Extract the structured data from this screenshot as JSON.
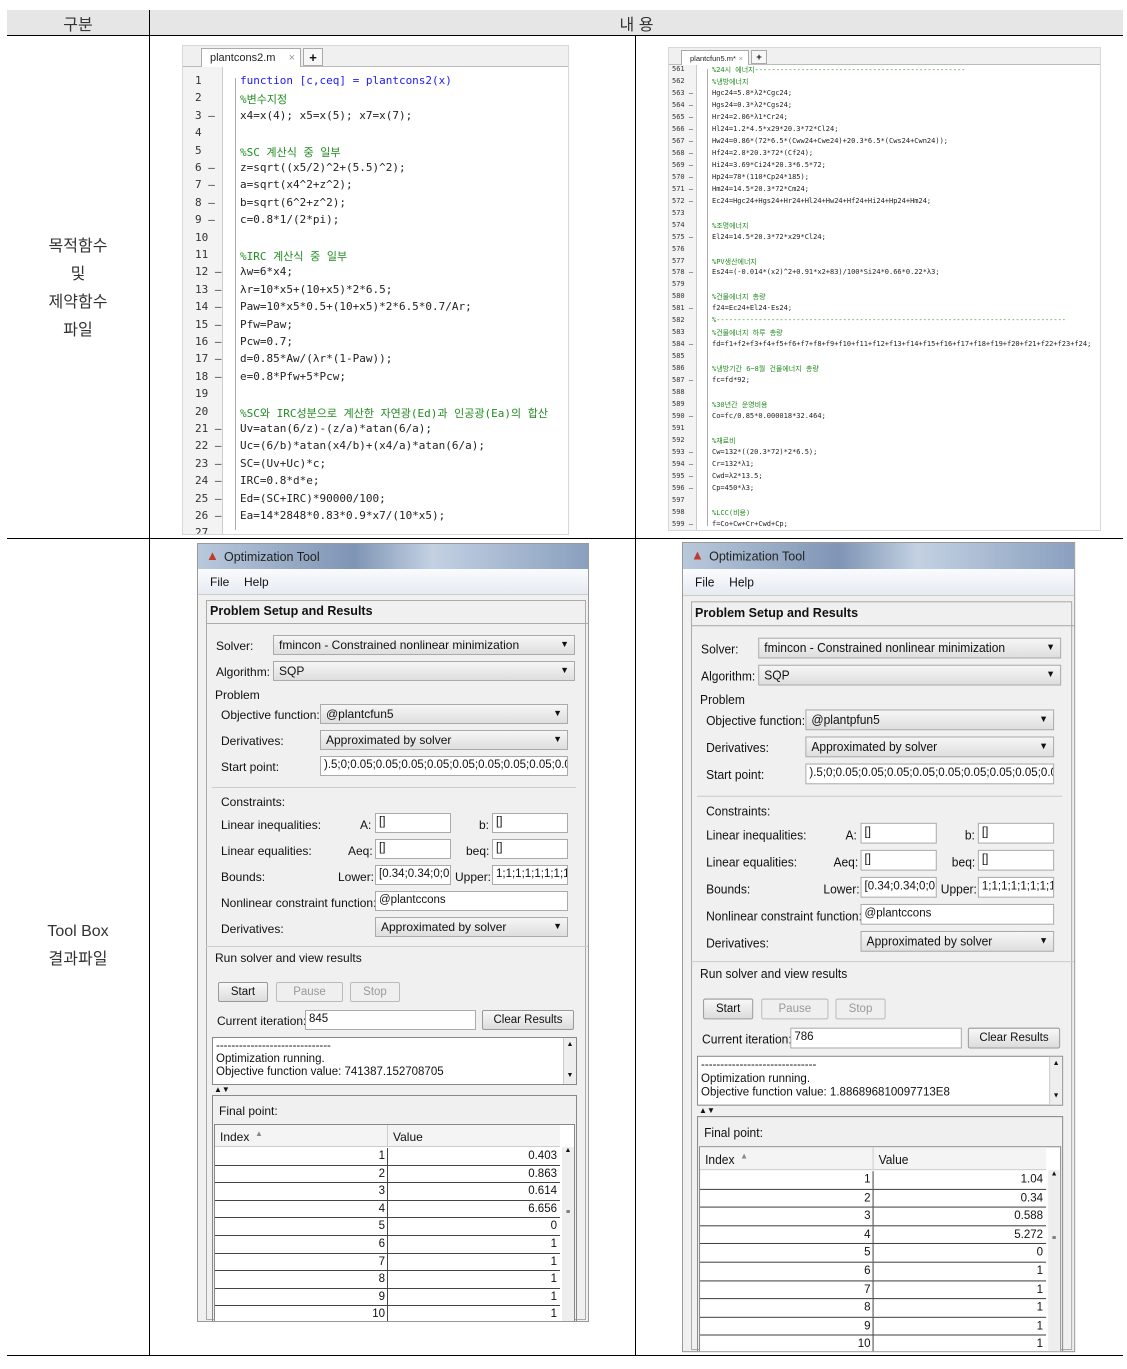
{
  "header": {
    "col1": "구분",
    "col2": "내 용"
  },
  "rows": [
    {
      "label_lines": [
        "목적함수",
        "및",
        "제약함수",
        "파일"
      ]
    },
    {
      "label_lines": [
        "Tool Box",
        "결과파일"
      ]
    }
  ],
  "editors": [
    {
      "tab": "plantcons2.m",
      "lines": [
        {
          "n": "1",
          "t": "function [c,ceq] = plantcons2(x)",
          "k": "fn"
        },
        {
          "n": "2",
          "t": "%변수지정",
          "k": "c"
        },
        {
          "n": "3 –",
          "t": "x4=x(4); x5=x(5); x7=x(7);"
        },
        {
          "n": "4",
          "t": ""
        },
        {
          "n": "5",
          "t": "%SC 계산식 중 일부",
          "k": "c"
        },
        {
          "n": "6 –",
          "t": "z=sqrt((x5/2)^2+(5.5)^2);"
        },
        {
          "n": "7 –",
          "t": "a=sqrt(x4^2+z^2);"
        },
        {
          "n": "8 –",
          "t": "b=sqrt(6^2+z^2);"
        },
        {
          "n": "9 –",
          "t": "c=0.8*1/(2*pi);"
        },
        {
          "n": "10",
          "t": ""
        },
        {
          "n": "11",
          "t": "%IRC 계산식 중 일부",
          "k": "c"
        },
        {
          "n": "12 –",
          "t": "λw=6*x4;"
        },
        {
          "n": "13 –",
          "t": "λr=10*x5+(10+x5)*2*6.5;"
        },
        {
          "n": "14 –",
          "t": "Paw=10*x5*0.5+(10+x5)*2*6.5*0.7/Ar;"
        },
        {
          "n": "15 –",
          "t": "Pfw=Paw;"
        },
        {
          "n": "16 –",
          "t": "Pcw=0.7;"
        },
        {
          "n": "17 –",
          "t": "d=0.85*Aw/(λr*(1-Paw));"
        },
        {
          "n": "18 –",
          "t": "e=0.8*Pfw+5*Pcw;"
        },
        {
          "n": "19",
          "t": ""
        },
        {
          "n": "20",
          "t": "%SC와 IRC성분으로 계산한 자연광(Ed)과 인공광(Ea)의 합산",
          "k": "c"
        },
        {
          "n": "21 –",
          "t": "Uv=atan(6/z)-(z/a)*atan(6/a);"
        },
        {
          "n": "22 –",
          "t": "Uc=(6/b)*atan(x4/b)+(x4/a)*atan(6/a);"
        },
        {
          "n": "23 –",
          "t": "SC=(Uv+Uc)*c;"
        },
        {
          "n": "24 –",
          "t": "IRC=0.8*d*e;"
        },
        {
          "n": "25 –",
          "t": "Ed=(SC+IRC)*90000/100;"
        },
        {
          "n": "26 –",
          "t": "Ea=14*2848*0.83*0.9*x7/(10*x5);"
        },
        {
          "n": "27",
          "t": ""
        }
      ]
    },
    {
      "tab": "plantcfun5.m*",
      "lines": [
        {
          "n": "561",
          "t": "%24시 에너지--------------------------------------------------",
          "k": "c"
        },
        {
          "n": "562",
          "t": "%냉방에너지",
          "k": "c"
        },
        {
          "n": "563 –",
          "t": "Hgc24=5.8*λ2*Cgc24;"
        },
        {
          "n": "564 –",
          "t": "Hgs24=0.3*λ2*Cgs24;"
        },
        {
          "n": "565 –",
          "t": "Hr24=2.06*λ1*Cr24;"
        },
        {
          "n": "566 –",
          "t": "Hl24=1.2*4.5*x29*20.3*72*Cl24;"
        },
        {
          "n": "567 –",
          "t": "Hw24=0.86*(72*6.5*(Cww24+Cwe24)+20.3*6.5*(Cws24+Cwn24));"
        },
        {
          "n": "568 –",
          "t": "Hf24=2.8*20.3*72*(Cf24);"
        },
        {
          "n": "569 –",
          "t": "Hi24=3.69*Ci24*20.3*6.5*72;"
        },
        {
          "n": "570 –",
          "t": "Hp24=78*(110*Cp24*185);"
        },
        {
          "n": "571 –",
          "t": "Hm24=14.5*20.3*72*Cm24;"
        },
        {
          "n": "572 –",
          "t": "Ec24=Hgc24+Hgs24+Hr24+Hl24+Hw24+Hf24+Hi24+Hp24+Hm24;"
        },
        {
          "n": "573",
          "t": ""
        },
        {
          "n": "574",
          "t": "%조명에너지",
          "k": "c"
        },
        {
          "n": "575 –",
          "t": "El24=14.5*20.3*72*x29*Cl24;"
        },
        {
          "n": "576",
          "t": ""
        },
        {
          "n": "577",
          "t": "%PV생산에너지",
          "k": "c"
        },
        {
          "n": "578 –",
          "t": "Es24=(-0.014*(x2)^2+0.91*x2+83)/100*Si24*0.66*0.22*λ3;"
        },
        {
          "n": "579",
          "t": ""
        },
        {
          "n": "580",
          "t": "%건물에너지 총량",
          "k": "c"
        },
        {
          "n": "581 –",
          "t": "f24=Ec24+El24-Es24;"
        },
        {
          "n": "582",
          "t": "%-----------------------------------------------------------------------------------",
          "k": "c"
        },
        {
          "n": "583",
          "t": "%건물에너지 하루 총량",
          "k": "c"
        },
        {
          "n": "584 –",
          "t": "fd=f1+f2+f3+f4+f5+f6+f7+f8+f9+f10+f11+f12+f13+f14+f15+f16+f17+f18+f19+f20+f21+f22+f23+f24;"
        },
        {
          "n": "585",
          "t": ""
        },
        {
          "n": "586",
          "t": "%냉방기간 6~8월 건물에너지 총량",
          "k": "c"
        },
        {
          "n": "587 –",
          "t": "fc=fd*92;"
        },
        {
          "n": "588",
          "t": ""
        },
        {
          "n": "589",
          "t": "%30년간 운영비용",
          "k": "c"
        },
        {
          "n": "590 –",
          "t": "Co=fc/0.85*0.000018*32.464;"
        },
        {
          "n": "591",
          "t": ""
        },
        {
          "n": "592",
          "t": "%재료비",
          "k": "c"
        },
        {
          "n": "593 –",
          "t": "Cw=132*((20.3*72)*2*6.5);"
        },
        {
          "n": "594 –",
          "t": "Cr=132*λ1;"
        },
        {
          "n": "595 –",
          "t": "Cwd=λ2*13.5;"
        },
        {
          "n": "596 –",
          "t": "Cp=450*λ3;"
        },
        {
          "n": "597",
          "t": ""
        },
        {
          "n": "598",
          "t": "%LCC(비용)",
          "k": "c"
        },
        {
          "n": "599 –",
          "t": "f=Co+Cw+Cr+Cwd+Cp;"
        }
      ]
    }
  ],
  "tools": [
    {
      "title": "Optimization Tool",
      "menu": [
        "File",
        "Help"
      ],
      "section": "Problem Setup and Results",
      "solver_label": "Solver:",
      "solver": "fmincon - Constrained nonlinear minimization",
      "algorithm_label": "Algorithm:",
      "algorithm": "SQP",
      "problem_label": "Problem",
      "objective_label": "Objective function:",
      "objective": "@plantcfun5",
      "derivatives_label": "Derivatives:",
      "derivatives": "Approximated by solver",
      "start_label": "Start point:",
      "start": ").5;0;0.05;0.05;0.05;0.05;0.05;0.05;0.05;0.05;0.05",
      "constraints_label": "Constraints:",
      "lin_ineq_label": "Linear inequalities:",
      "A_label": "A:",
      "A": "[]",
      "b_label": "b:",
      "b": "[]",
      "lin_eq_label": "Linear equalities:",
      "Aeq_label": "Aeq:",
      "Aeq": "[]",
      "beq_label": "beq:",
      "beq": "[]",
      "bounds_label": "Bounds:",
      "lower_label": "Lower:",
      "lower": "[0.34;0.34;0;0",
      "upper_label": "Upper:",
      "upper": "1;1;1;1;1;1;1;1",
      "nonlin_label": "Nonlinear constraint function:",
      "nonlin": "@plantccons",
      "nl_derivatives_label": "Derivatives:",
      "nl_derivatives": "Approximated by solver",
      "run_label": "Run solver and view results",
      "start_btn": "Start",
      "pause_btn": "Pause",
      "stop_btn": "Stop",
      "iter_label": "Current iteration:",
      "iter": "845",
      "clear_btn": "Clear Results",
      "output": [
        "------------------------------",
        "Optimization running.",
        "Objective function value: 741387.152708705"
      ],
      "final_label": "Final point:",
      "col_index": "Index",
      "col_value": "Value",
      "points": [
        [
          "1",
          "0.403"
        ],
        [
          "2",
          "0.863"
        ],
        [
          "3",
          "0.614"
        ],
        [
          "4",
          "6.656"
        ],
        [
          "5",
          "0"
        ],
        [
          "6",
          "1"
        ],
        [
          "7",
          "1"
        ],
        [
          "8",
          "1"
        ],
        [
          "9",
          "1"
        ],
        [
          "10",
          "1"
        ]
      ]
    },
    {
      "title": "Optimization Tool",
      "menu": [
        "File",
        "Help"
      ],
      "section": "Problem Setup and Results",
      "solver_label": "Solver:",
      "solver": "fmincon - Constrained nonlinear minimization",
      "algorithm_label": "Algorithm:",
      "algorithm": "SQP",
      "problem_label": "Problem",
      "objective_label": "Objective function:",
      "objective": "@plantpfun5",
      "derivatives_label": "Derivatives:",
      "derivatives": "Approximated by solver",
      "start_label": "Start point:",
      "start": ").5;0;0.05;0.05;0.05;0.05;0.05;0.05;0.05;0.05;0.05",
      "constraints_label": "Constraints:",
      "lin_ineq_label": "Linear inequalities:",
      "A_label": "A:",
      "A": "[]",
      "b_label": "b:",
      "b": "[]",
      "lin_eq_label": "Linear equalities:",
      "Aeq_label": "Aeq:",
      "Aeq": "[]",
      "beq_label": "beq:",
      "beq": "[]",
      "bounds_label": "Bounds:",
      "lower_label": "Lower:",
      "lower": "[0.34;0.34;0;0",
      "upper_label": "Upper:",
      "upper": "1;1;1;1;1;1;1;1",
      "nonlin_label": "Nonlinear constraint function:",
      "nonlin": "@plantccons",
      "nl_derivatives_label": "Derivatives:",
      "nl_derivatives": "Approximated by solver",
      "run_label": "Run solver and view results",
      "start_btn": "Start",
      "pause_btn": "Pause",
      "stop_btn": "Stop",
      "iter_label": "Current iteration:",
      "iter": "786",
      "clear_btn": "Clear Results",
      "output": [
        "------------------------------",
        "Optimization running.",
        "Objective function value: 1.886896810097713E8"
      ],
      "final_label": "Final point:",
      "col_index": "Index",
      "col_value": "Value",
      "points": [
        [
          "1",
          "1.04"
        ],
        [
          "2",
          "0.34"
        ],
        [
          "3",
          "0.588"
        ],
        [
          "4",
          "5.272"
        ],
        [
          "5",
          "0"
        ],
        [
          "6",
          "1"
        ],
        [
          "7",
          "1"
        ],
        [
          "8",
          "1"
        ],
        [
          "9",
          "1"
        ],
        [
          "10",
          "1"
        ]
      ]
    }
  ]
}
